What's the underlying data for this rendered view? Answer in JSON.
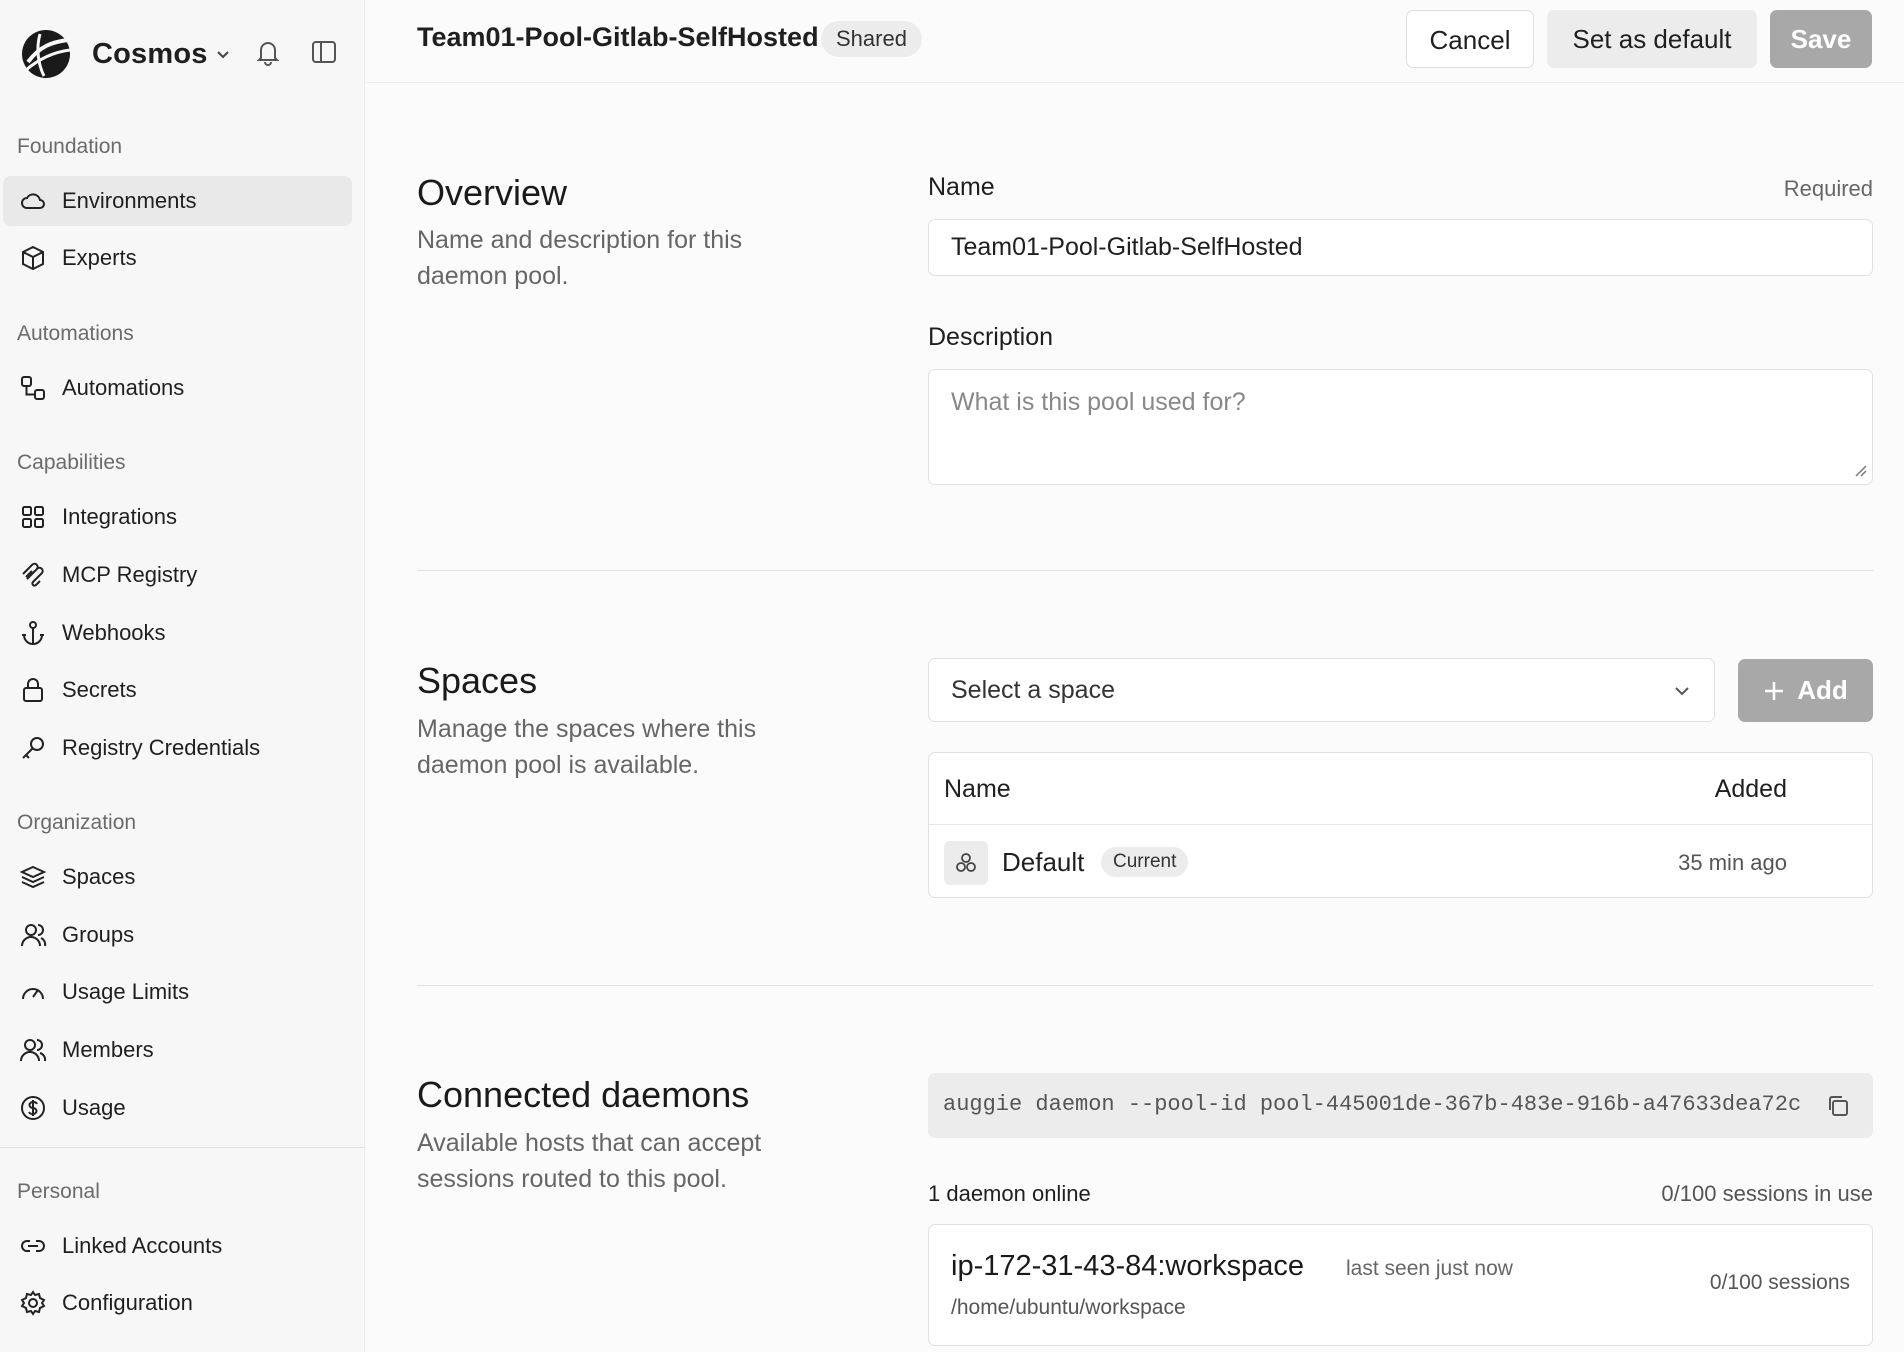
{
  "sidebar": {
    "org_name": "Cosmos",
    "sections": {
      "foundation": "Foundation",
      "automations": "Automations",
      "capabilities": "Capabilities",
      "organization": "Organization",
      "personal": "Personal"
    },
    "items": {
      "environments": "Environments",
      "experts": "Experts",
      "automations": "Automations",
      "integrations": "Integrations",
      "mcp_registry": "MCP Registry",
      "webhooks": "Webhooks",
      "secrets": "Secrets",
      "registry_credentials": "Registry Credentials",
      "spaces": "Spaces",
      "groups": "Groups",
      "usage_limits": "Usage Limits",
      "members": "Members",
      "usage": "Usage",
      "linked_accounts": "Linked Accounts",
      "configuration": "Configuration"
    },
    "active_item": "environments"
  },
  "header": {
    "title": "Team01-Pool-Gitlab-SelfHosted",
    "badge": "Shared",
    "cancel_label": "Cancel",
    "set_default_label": "Set as default",
    "save_label": "Save"
  },
  "overview": {
    "title": "Overview",
    "description": "Name and description for this daemon pool.",
    "name_label": "Name",
    "name_required": "Required",
    "name_value": "Team01-Pool-Gitlab-SelfHosted",
    "description_label": "Description",
    "description_placeholder": "What is this pool used for?"
  },
  "spaces": {
    "title": "Spaces",
    "description": "Manage the spaces where this daemon pool is available.",
    "select_placeholder": "Select a space",
    "add_label": "Add",
    "col_name": "Name",
    "col_added": "Added",
    "rows": [
      {
        "name": "Default",
        "badge": "Current",
        "added": "35 min ago"
      }
    ]
  },
  "daemons": {
    "title": "Connected daemons",
    "description": "Available hosts that can accept sessions routed to this pool.",
    "command": "auggie daemon --pool-id pool-445001de-367b-483e-916b-a47633dea72c",
    "online_label": "1 daemon online",
    "sessions_in_use": "0/100 sessions in use",
    "list": [
      {
        "host": "ip-172-31-43-84:workspace",
        "last_seen": "last seen just now",
        "path": "/home/ubuntu/workspace",
        "sessions": "0/100 sessions"
      }
    ]
  },
  "colors": {
    "accent_disabled": "#a8a8a8",
    "active_nav_bg": "#e9e9e9",
    "page_bg": "#fbfbfb"
  },
  "icons": [
    "cosmos-logo",
    "chevron-down-icon",
    "bell-icon",
    "sidebar-toggle-icon",
    "cloud-icon",
    "cube-icon",
    "flow-icon",
    "grid-icon",
    "mcp-icon",
    "anchor-icon",
    "lock-icon",
    "key-icon",
    "layers-icon",
    "user-icon",
    "gauge-icon",
    "users-icon",
    "dollar-icon",
    "link-icon",
    "gear-icon",
    "plus-icon",
    "cluster-icon",
    "copy-icon"
  ]
}
